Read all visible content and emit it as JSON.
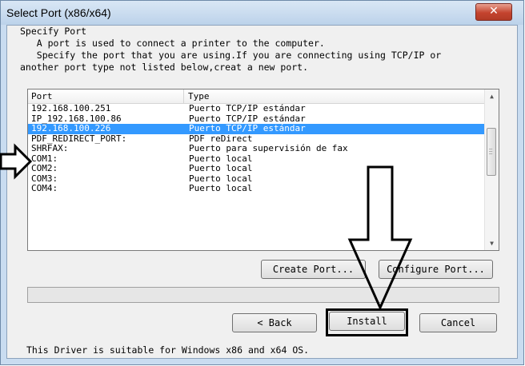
{
  "window": {
    "title": "Select Port (x86/x64)",
    "close_glyph": "✕"
  },
  "description": {
    "heading": "Specify Port",
    "line1": "   A port is used to connect a printer to the computer.",
    "line2": "   Specify the port that you are using.If you are connecting using TCP/IP or",
    "line3": "another port type not listed below,creat a new port."
  },
  "port_list": {
    "columns": [
      "Port",
      "Type"
    ],
    "rows": [
      {
        "port": "192.168.100.251",
        "type": "Puerto TCP/IP estándar",
        "selected": false
      },
      {
        "port": "IP_192.168.100.86",
        "type": "Puerto TCP/IP estándar",
        "selected": false
      },
      {
        "port": "192.168.100.226",
        "type": "Puerto TCP/IP estándar",
        "selected": true
      },
      {
        "port": "PDF_REDIRECT_PORT:",
        "type": "PDF reDirect",
        "selected": false
      },
      {
        "port": "SHRFAX:",
        "type": "Puerto para supervisión de fax",
        "selected": false
      },
      {
        "port": "COM1:",
        "type": "Puerto local",
        "selected": false
      },
      {
        "port": "COM2:",
        "type": "Puerto local",
        "selected": false
      },
      {
        "port": "COM3:",
        "type": "Puerto local",
        "selected": false
      },
      {
        "port": "COM4:",
        "type": "Puerto local",
        "selected": false
      }
    ],
    "scroll_up_glyph": "▲",
    "scroll_down_glyph": "▼"
  },
  "buttons": {
    "create_port": "Create Port...",
    "configure_port": "Configure Port...",
    "back": "< Back",
    "install": "Install",
    "cancel": "Cancel"
  },
  "footer_text": "This Driver is suitable for Windows x86 and x64 OS.",
  "icons": {
    "close": "close-icon",
    "annotation_arrows": [
      "right-arrow-icon",
      "down-arrow-icon"
    ]
  },
  "colors": {
    "selection": "#3399ff",
    "close_button": "#c4442f",
    "title_bar": "#c9dcf0"
  }
}
